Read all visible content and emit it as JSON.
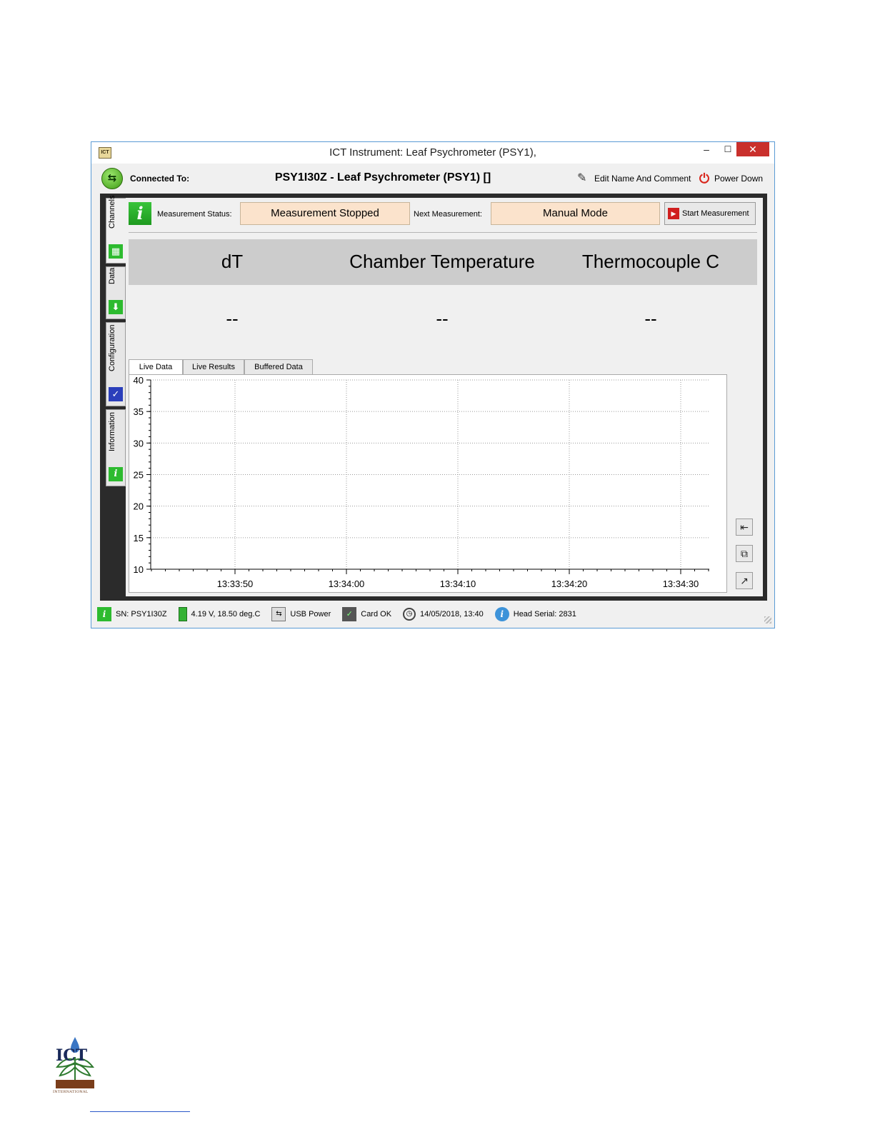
{
  "window": {
    "title": "ICT Instrument: Leaf Psychrometer (PSY1),",
    "app_icon": "ICT",
    "controls": {
      "minimize": "–",
      "maximize": "☐",
      "close": "✕"
    }
  },
  "connection": {
    "label": "Connected To:",
    "device": "PSY1I30Z - Leaf Psychrometer (PSY1) []",
    "edit_label": "Edit Name And Comment",
    "power_label": "Power Down"
  },
  "side_tabs": [
    {
      "label": "Channels",
      "icon": "grid-icon",
      "color": "#2dbb2f"
    },
    {
      "label": "Data",
      "icon": "download-arrow-icon",
      "color": "#2dbb2f"
    },
    {
      "label": "Configuration",
      "icon": "wrench-icon",
      "color": "#2b3fbb"
    },
    {
      "label": "Information",
      "icon": "info-icon",
      "color": "#2dbb2f"
    }
  ],
  "status": {
    "measurement_label": "Measurement Status:",
    "measurement_value": "Measurement Stopped",
    "next_label": "Next Measurement:",
    "next_value": "Manual Mode",
    "start_button": "Start Measurement"
  },
  "channels": {
    "headers": [
      "dT",
      "Chamber Temperature",
      "Thermocouple C"
    ],
    "values": [
      "--",
      "--",
      "--"
    ]
  },
  "chart_tabs": [
    "Live Data",
    "Live Results",
    "Buffered Data"
  ],
  "chart_data": {
    "type": "line",
    "title": "",
    "xlabel": "",
    "ylabel": "",
    "ylim": [
      10,
      40
    ],
    "y_ticks": [
      10,
      15,
      20,
      25,
      30,
      35,
      40
    ],
    "x_ticks": [
      "13:33:50",
      "13:34:00",
      "13:34:10",
      "13:34:20",
      "13:34:30"
    ],
    "grid": true,
    "series": []
  },
  "side_buttons": [
    "export-icon",
    "copy-icon",
    "popout-icon"
  ],
  "statusbar": {
    "serial": "SN: PSY1I30Z",
    "battery": "4.19 V, 18.50 deg.C",
    "power": "USB Power",
    "card": "Card OK",
    "datetime": "14/05/2018, 13:40",
    "head_serial": "Head Serial: 2831"
  },
  "logo": {
    "text": "ICT",
    "subtext": "INTERNATIONAL"
  }
}
